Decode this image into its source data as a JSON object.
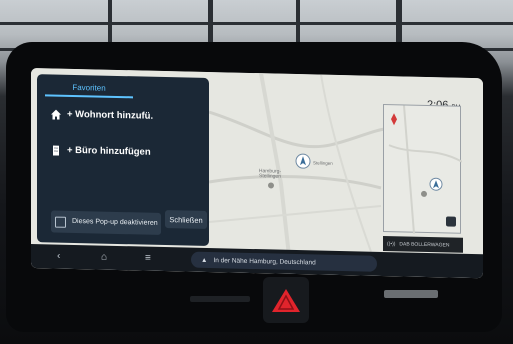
{
  "favorites": {
    "tab_label": "Favoriten",
    "items": [
      {
        "icon": "home-icon",
        "label": "+ Wohnort hinzufü."
      },
      {
        "icon": "building-icon",
        "label": "+ Büro hinzufügen"
      }
    ],
    "popup_checkbox_label": "Dieses Pop-up deaktivieren",
    "close_label": "Schließen"
  },
  "map": {
    "place_label_1": "Hamburg-Stellingen",
    "place_label_2": "Stellingen",
    "clock": "2:06",
    "clock_suffix": "PM",
    "radio_label": "DAB BOLLERWAGEN"
  },
  "bottom_bar": {
    "location_text": "In der Nähe Hamburg, Deutschland",
    "icons": [
      "back-icon",
      "home-icon",
      "menu-icon",
      "navigation-arrow-icon"
    ]
  },
  "colors": {
    "accent": "#5ec3ff",
    "panel": "#1b2836",
    "hazard": "#e0242c"
  }
}
